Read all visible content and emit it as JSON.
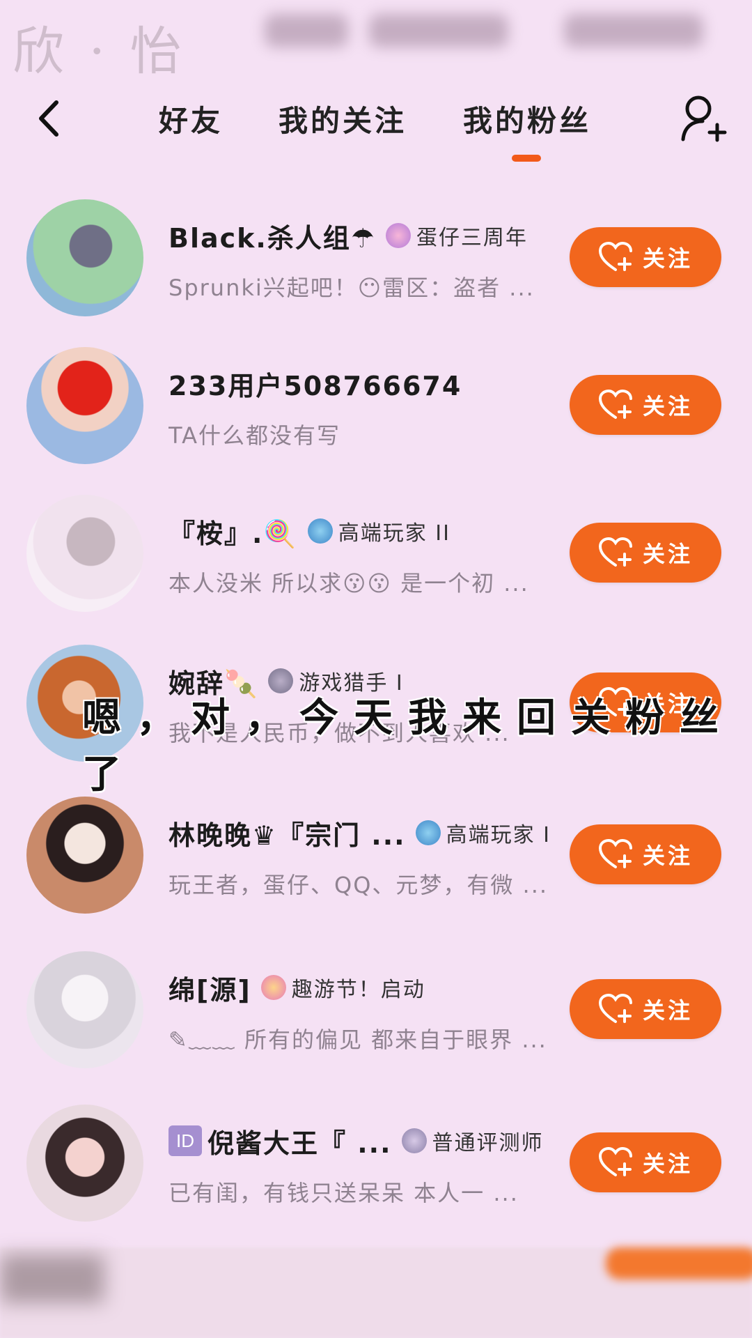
{
  "watermark": "欣 · 怡",
  "nav": {
    "tabs": [
      "好友",
      "我的关注",
      "我的粉丝"
    ],
    "active_tab": "我的粉丝"
  },
  "colors": {
    "accent": "#f2661d",
    "background": "#f5e1f4"
  },
  "caption": "嗯，对，今天我来回关粉丝了",
  "follow_label": "关注",
  "fans": [
    {
      "name": "Black.杀人组☂",
      "badge": "蛋仔三周年",
      "desc": "Sprunki兴起吧！😶雷区：盗者 ..."
    },
    {
      "name": "233用户508766674",
      "badge": "",
      "desc": "TA什么都没有写"
    },
    {
      "name": "『桉』.🍭",
      "badge": "高端玩家 II",
      "desc": "本人没米 所以求😗😗 是一个初 ..."
    },
    {
      "name": "婉辞🍡",
      "badge": "游戏猎手 I",
      "desc": "我不是人民币，做不到人喜欢 ..."
    },
    {
      "name": "林晚晚♛『宗门 ...",
      "badge": "高端玩家 I",
      "desc": "玩王者，蛋仔、QQ、元梦，有微 ..."
    },
    {
      "name": "绵[源]",
      "badge": "趣游节！启动",
      "desc": "✎﹏﹏ 所有的偏见 都来自于眼界 ..."
    },
    {
      "name": "倪酱大王『 ...",
      "id_tag": "ID",
      "badge": "普通评测师",
      "desc": "已有闺，有钱只送呆呆 本人一 ..."
    }
  ]
}
